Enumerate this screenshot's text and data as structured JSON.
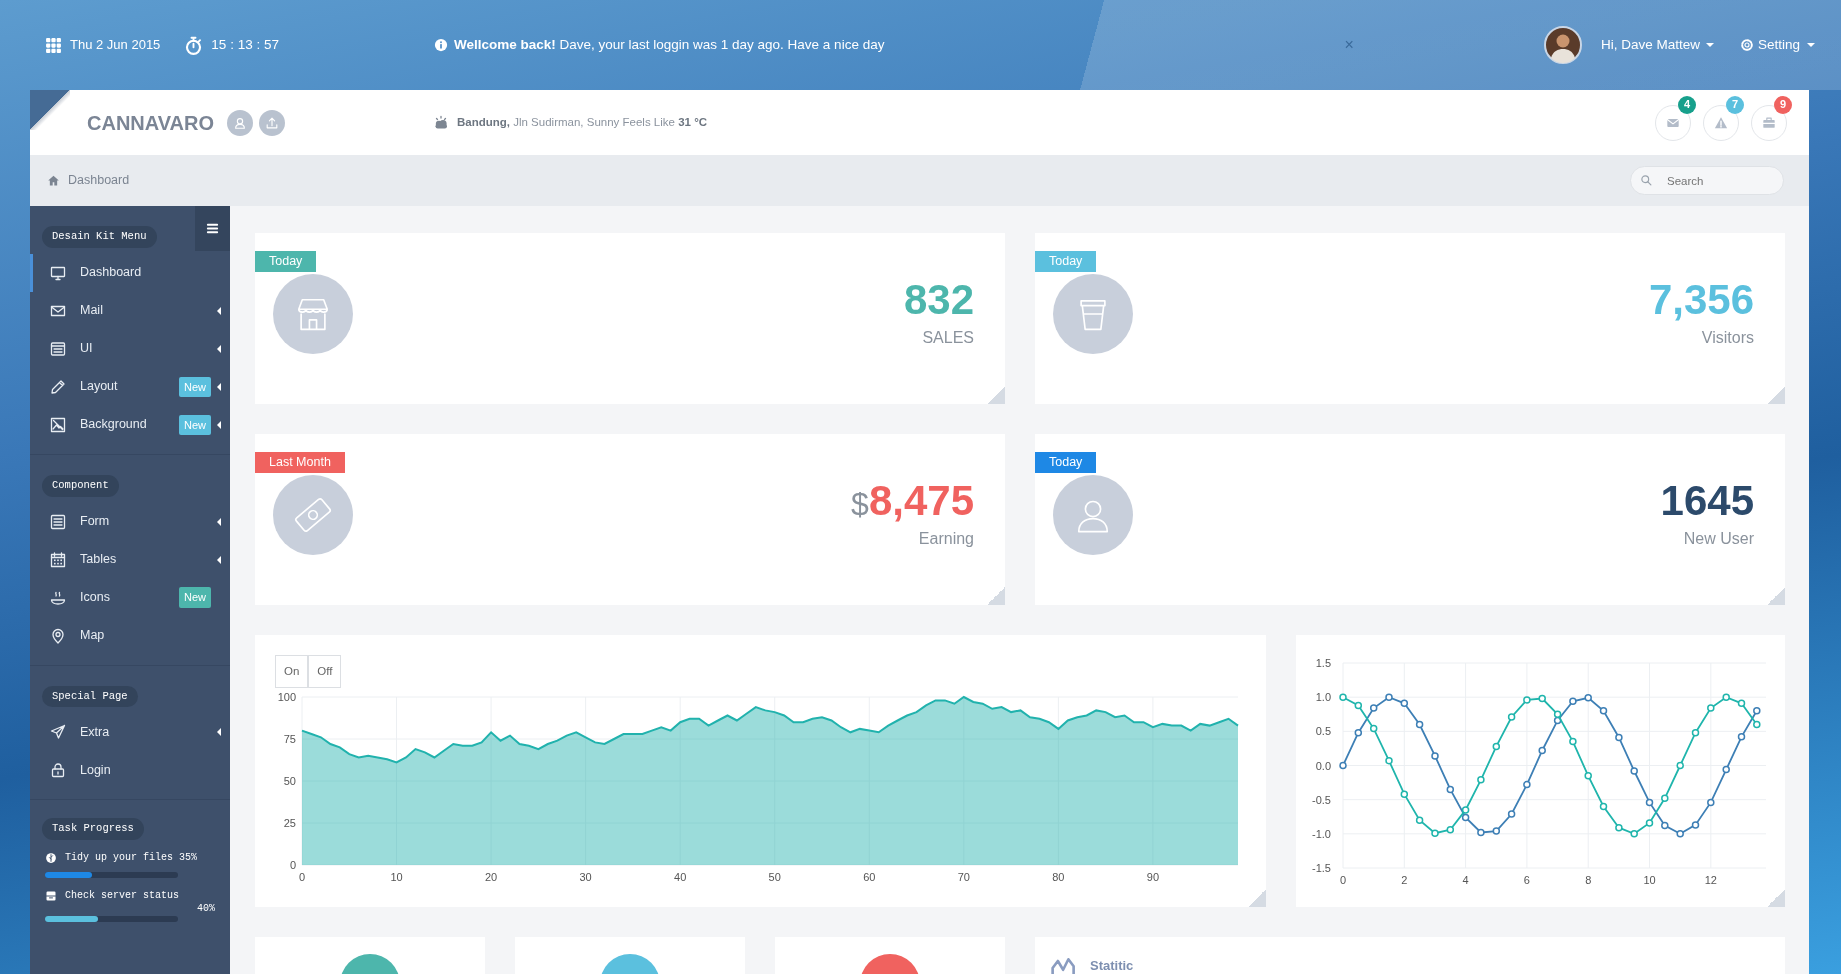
{
  "topbar": {
    "date": "Thu 2 Jun 2015",
    "time": "15 : 13 : 57",
    "message": "**Wellcome back!** Dave, your last loggin was 1 day ago. Have a nice day",
    "close": "×",
    "user": "Hi, Dave Mattew",
    "settings": "Setting"
  },
  "header": {
    "brand": "CANNAVARO",
    "weather": "**Bandung,** Jln Sudirman, Sunny Feels Like **31 °C**",
    "notifications": [
      {
        "count": "4",
        "color": "#17a08c"
      },
      {
        "count": "7",
        "color": "#5bc0de"
      },
      {
        "count": "9",
        "color": "#f0625f"
      }
    ]
  },
  "breadcrumb": {
    "label": "Dashboard",
    "search": {
      "placeholder": "Search"
    }
  },
  "sidebar": {
    "sections": [
      {
        "title": "Desain Kit Menu",
        "items": [
          {
            "label": "Dashboard",
            "selected": true,
            "has_submenu": false
          },
          {
            "label": "Mail",
            "selected": false,
            "has_submenu": true
          },
          {
            "label": "UI",
            "selected": false,
            "has_submenu": true
          },
          {
            "label": "Layout",
            "selected": false,
            "has_submenu": true,
            "badge": "New",
            "color": "#5bc0de"
          },
          {
            "label": "Background",
            "selected": false,
            "has_submenu": true,
            "badge": "New",
            "color": "#5bc0de"
          }
        ]
      },
      {
        "title": "Component",
        "items": [
          {
            "label": "Form",
            "selected": false,
            "has_submenu": true
          },
          {
            "label": "Tables",
            "selected": false,
            "has_submenu": true
          },
          {
            "label": "Icons",
            "selected": false,
            "has_submenu": false,
            "badge": "New",
            "color": "#4db6ac"
          },
          {
            "label": "Map",
            "selected": false,
            "has_submenu": false
          }
        ]
      },
      {
        "title": "Special Page",
        "items": [
          {
            "label": "Extra",
            "selected": false,
            "has_submenu": true
          },
          {
            "label": "Login",
            "selected": false,
            "has_submenu": false
          }
        ]
      }
    ],
    "task_progress": {
      "title": "Task Progress",
      "tasks": [
        {
          "label": "Tidy up your files 35%",
          "level": 0.35,
          "color": "#1e88e5"
        },
        {
          "label": "Check server status",
          "reading": "40%",
          "level": 0.4,
          "color": "#5bc0de"
        }
      ]
    }
  },
  "stats": [
    {
      "tag": {
        "label": "Today",
        "color": "#4db6ac"
      },
      "value": {
        "text": "832",
        "color": "#4db6ac"
      },
      "caption": "SALES"
    },
    {
      "tag": {
        "label": "Today",
        "color": "#5bc0de"
      },
      "value": {
        "text": "7,356",
        "color": "#5bc0de"
      },
      "caption": "Visitors"
    },
    {
      "tag": {
        "label": "Last Month",
        "color": "#f0625f"
      },
      "value": {
        "prefix": "$",
        "text": "8,475",
        "color": "#f0625f"
      },
      "caption": "Earning"
    },
    {
      "tag": {
        "label": "Today",
        "color": "#1e88e5"
      },
      "value": {
        "text": "1645",
        "color": "#2c4a6b"
      },
      "caption": "New User"
    }
  ],
  "area_chart": {
    "toggles": [
      "On",
      "Off"
    ],
    "chart_data": {
      "type": "area",
      "x": [
        0,
        1,
        2,
        3,
        4,
        5,
        6,
        7,
        8,
        9,
        10,
        11,
        12,
        13,
        14,
        15,
        16,
        17,
        18,
        19,
        20,
        21,
        22,
        23,
        24,
        25,
        26,
        27,
        28,
        29,
        30,
        31,
        32,
        33,
        34,
        35,
        36,
        37,
        38,
        39,
        40,
        41,
        42,
        43,
        44,
        45,
        46,
        47,
        48,
        49,
        50,
        51,
        52,
        53,
        54,
        55,
        56,
        57,
        58,
        59,
        60,
        61,
        62,
        63,
        64,
        65,
        66,
        67,
        68,
        69,
        70,
        71,
        72,
        73,
        74,
        75,
        76,
        77,
        78,
        79,
        80,
        81,
        82,
        83,
        84,
        85,
        86,
        87,
        88,
        89,
        90,
        91,
        92,
        93,
        94,
        95,
        96,
        97,
        98,
        99
      ],
      "grid": true,
      "series": [
        {
          "color": "#21b2ad",
          "values": [
            80,
            78,
            76,
            72,
            70,
            66,
            64,
            65,
            64,
            63,
            61,
            64,
            69,
            67,
            64,
            68,
            72,
            71,
            71,
            73,
            79,
            74,
            77,
            72,
            71,
            69,
            72,
            74,
            77,
            79,
            76,
            73,
            72,
            75,
            78,
            78,
            78,
            80,
            82,
            80,
            85,
            87,
            87,
            83,
            86,
            89,
            86,
            90,
            94,
            92,
            91,
            89,
            85,
            85,
            87,
            88,
            86,
            82,
            79,
            81,
            80,
            79,
            83,
            86,
            89,
            91,
            95,
            98,
            98,
            96,
            100,
            97,
            96,
            93,
            94,
            91,
            92,
            88,
            87,
            85,
            81,
            86,
            88,
            89,
            92,
            91,
            88,
            89,
            85,
            85,
            82,
            84,
            83,
            83,
            80,
            84,
            83,
            85,
            87,
            83
          ]
        }
      ],
      "xlim": [
        0,
        99
      ],
      "ylim": [
        0,
        100
      ],
      "xticks": [
        0,
        10,
        20,
        30,
        40,
        50,
        60,
        70,
        80,
        90
      ],
      "yticks": [
        0,
        25,
        50,
        75,
        100
      ]
    }
  },
  "line_chart": {
    "chart_data": {
      "type": "line",
      "x": [
        0,
        0.5,
        1,
        1.5,
        2,
        2.5,
        3,
        3.5,
        4,
        4.5,
        5,
        5.5,
        6,
        6.5,
        7,
        7.5,
        8,
        8.5,
        9,
        9.5,
        10,
        10.5,
        11,
        11.5,
        12,
        12.5,
        13,
        13.5
      ],
      "grid": true,
      "series": [
        {
          "color": "#3d7fb5",
          "marker": true,
          "values": [
            0,
            0.48,
            0.84,
            1.0,
            0.91,
            0.6,
            0.14,
            -0.35,
            -0.76,
            -0.98,
            -0.96,
            -0.71,
            -0.28,
            0.22,
            0.66,
            0.94,
            0.99,
            0.8,
            0.41,
            -0.08,
            -0.54,
            -0.88,
            -1.0,
            -0.87,
            -0.54,
            -0.06,
            0.42,
            0.8
          ]
        },
        {
          "color": "#1fb5ac",
          "marker": true,
          "values": [
            1,
            0.88,
            0.54,
            0.07,
            -0.42,
            -0.8,
            -0.99,
            -0.94,
            -0.65,
            -0.21,
            0.28,
            0.71,
            0.96,
            0.98,
            0.75,
            0.35,
            -0.15,
            -0.6,
            -0.91,
            -1.0,
            -0.84,
            -0.48,
            0.0,
            0.48,
            0.84,
            1.0,
            0.91,
            0.6
          ]
        }
      ],
      "xlim": [
        0,
        13.8
      ],
      "ylim": [
        -1.5,
        1.5
      ],
      "xticks": [
        0,
        2,
        4,
        6,
        8,
        10,
        12
      ],
      "yticks": [
        {
          "value": -1.5,
          "label": "-1.5"
        },
        {
          "value": -1,
          "label": "-1.0"
        },
        {
          "value": -0.5,
          "label": "-0.5"
        },
        {
          "value": 0,
          "label": "0.0"
        },
        {
          "value": 0.5,
          "label": "0.5"
        },
        {
          "value": 1,
          "label": "1.0"
        },
        {
          "value": 1.5,
          "label": "1.5"
        }
      ]
    }
  },
  "summary_cards": [
    {
      "color": "#4db6ac"
    },
    {
      "color": "#5bc0de"
    },
    {
      "color": "#f0625f"
    }
  ],
  "statistic": {
    "title": "Statitic"
  }
}
